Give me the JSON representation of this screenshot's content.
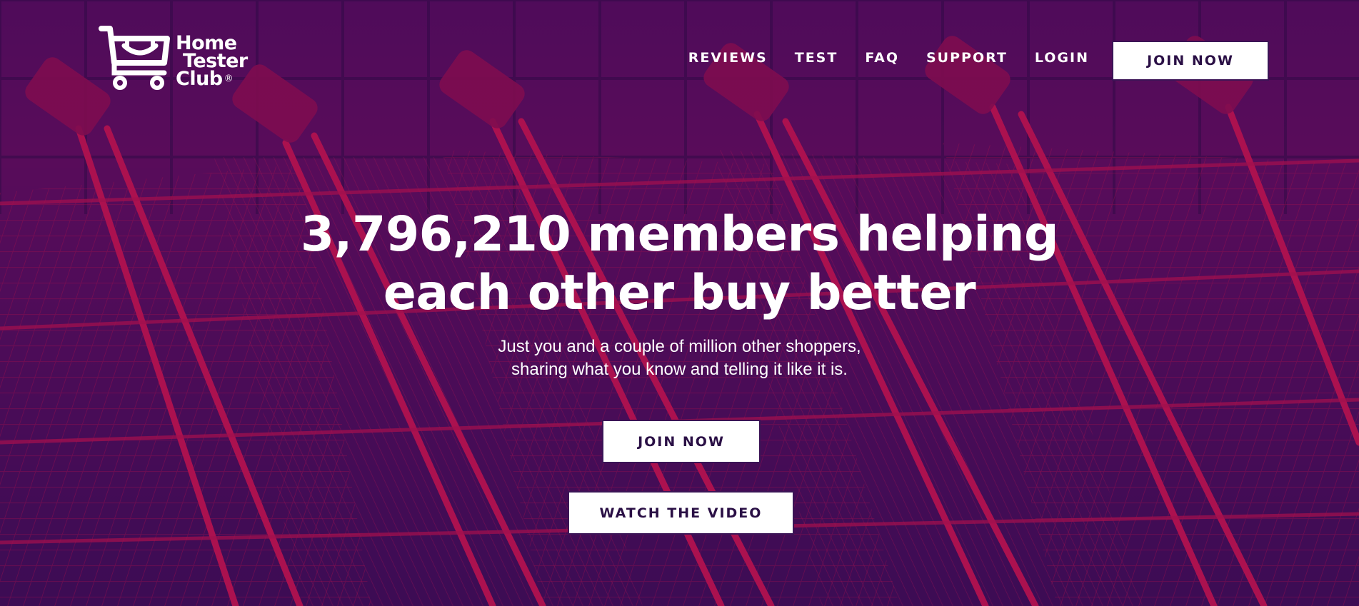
{
  "brand": {
    "logo_line1": "Home",
    "logo_line2": "Tester",
    "logo_line3": "Club",
    "registered_mark": "®",
    "logo_icon": "shopping-cart-smile-icon"
  },
  "nav": {
    "items": [
      {
        "label": "REVIEWS"
      },
      {
        "label": "TEST"
      },
      {
        "label": "FAQ"
      },
      {
        "label": "SUPPORT"
      },
      {
        "label": "LOGIN"
      }
    ],
    "join_label": "JOIN NOW"
  },
  "hero": {
    "headline_line1": "3,796,210 members helping",
    "headline_line2": "each other buy better",
    "sub_line1": "Just you and a couple of million other shoppers,",
    "sub_line2": "sharing what you know and telling it like it is.",
    "join_label": "JOIN NOW",
    "video_label": "WATCH THE VIDEO",
    "background_icon": "shopping-trolleys-photo"
  },
  "colors": {
    "overlay_dark": "#4a0f5e",
    "accent_pink": "#e8164e",
    "button_text": "#2a0f45"
  }
}
